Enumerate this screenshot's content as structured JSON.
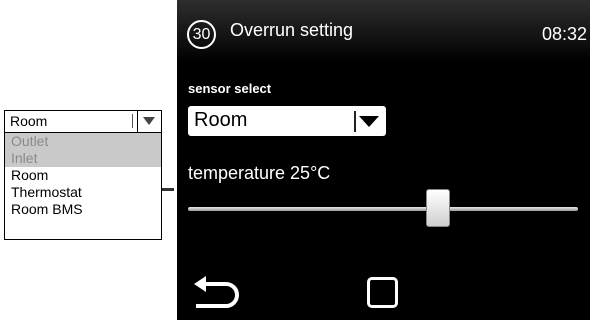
{
  "dropdown_popup": {
    "selected": "Room",
    "options": [
      {
        "label": "Outlet",
        "disabled": true
      },
      {
        "label": "Inlet",
        "disabled": true
      },
      {
        "label": "Room",
        "disabled": false
      },
      {
        "label": "Thermostat",
        "disabled": false
      },
      {
        "label": "Room BMS",
        "disabled": false
      }
    ]
  },
  "screen": {
    "badge_number": "30",
    "title": "Overrun setting",
    "time": "08:32",
    "sensor_label": "sensor select",
    "sensor_value": "Room",
    "temperature_label": "temperature 25°C",
    "slider": {
      "min": 0,
      "max": 100,
      "value": 64
    },
    "icons": {
      "back": "back-arrow-icon",
      "home": "square-icon"
    }
  }
}
